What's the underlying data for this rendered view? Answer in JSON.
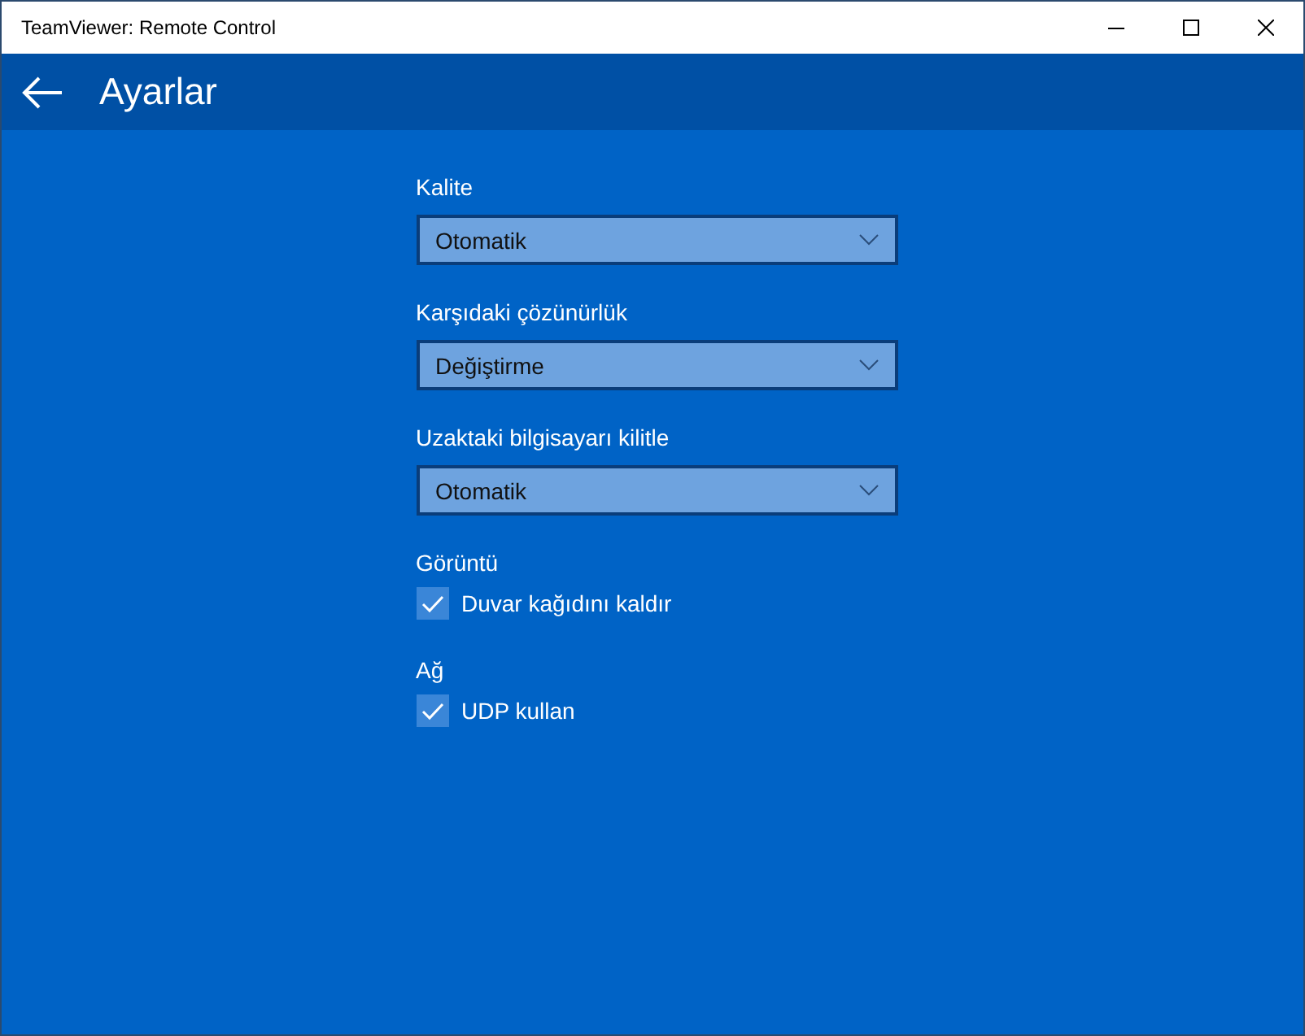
{
  "window": {
    "title": "TeamViewer: Remote Control"
  },
  "header": {
    "title": "Ayarlar"
  },
  "settings": [
    {
      "kind": "dropdown",
      "label": "Kalite",
      "value": "Otomatik"
    },
    {
      "kind": "dropdown",
      "label": "Karşıdaki çözünürlük",
      "value": "Değiştirme"
    },
    {
      "kind": "dropdown",
      "label": "Uzaktaki bilgisayarı kilitle",
      "value": "Otomatik"
    },
    {
      "kind": "checkbox",
      "label": "Görüntü",
      "option": "Duvar kağıdını kaldır",
      "checked": true
    },
    {
      "kind": "checkbox",
      "label": "Ağ",
      "option": "UDP kullan",
      "checked": true
    }
  ]
}
